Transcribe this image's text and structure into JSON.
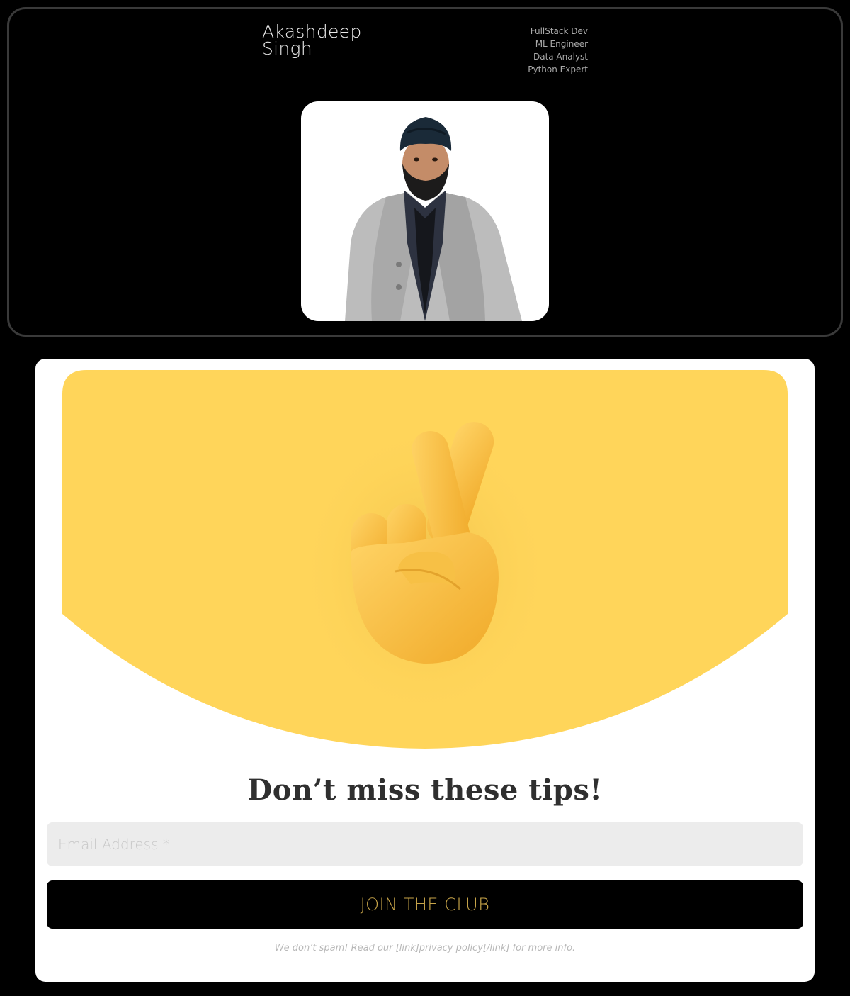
{
  "header": {
    "name": "Akashdeep Singh",
    "roles": [
      "FullStack Dev",
      "ML Engineer",
      "Data Analyst",
      "Python Expert"
    ]
  },
  "profile_photo": {
    "icon": "person-portrait"
  },
  "signup": {
    "hero_icon": "crossed-fingers-emoji",
    "accent_color": "#FFD55A",
    "headline": "Don’t miss these tips!",
    "email_placeholder": "Email Address *",
    "email_value": "",
    "button_label": "JOIN THE CLUB",
    "disclaimer": "We don’t spam! Read our [link]privacy policy[/link] for more info."
  }
}
